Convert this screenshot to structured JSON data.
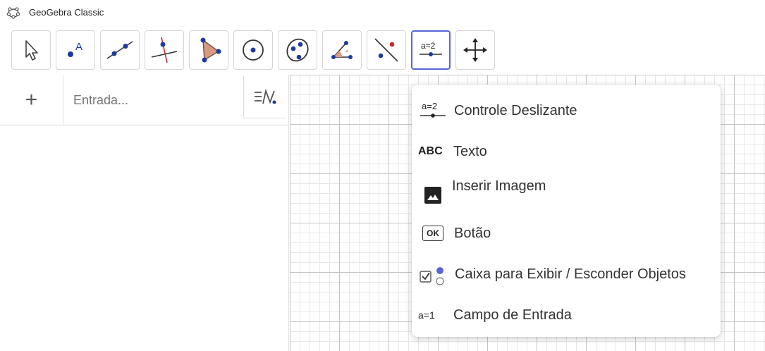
{
  "window": {
    "title": "GeoGebra Classic",
    "icon": "geogebra-logo-icon"
  },
  "toolbar": {
    "tools": [
      {
        "name": "move-tool",
        "icon": "cursor-arrow-icon"
      },
      {
        "name": "point-tool",
        "icon": "point-a-icon",
        "glyph": "A"
      },
      {
        "name": "line-tool",
        "icon": "line-through-points-icon"
      },
      {
        "name": "perpendicular-line-tool",
        "icon": "perpendicular-line-icon"
      },
      {
        "name": "polygon-tool",
        "icon": "polygon-icon"
      },
      {
        "name": "circle-tool",
        "icon": "circle-center-point-icon"
      },
      {
        "name": "ellipse-tool",
        "icon": "ellipse-icon"
      },
      {
        "name": "angle-tool",
        "icon": "angle-icon"
      },
      {
        "name": "reflect-tool",
        "icon": "reflect-about-line-icon"
      },
      {
        "name": "slider-tool",
        "icon": "slider-icon",
        "glyph": "a=2",
        "active": true
      },
      {
        "name": "move-graphics-view-tool",
        "icon": "move-graphics-view-icon"
      }
    ]
  },
  "algebra": {
    "add_label": "+",
    "input_placeholder": "Entrada...",
    "style_bar_icon": "algebra-style-icon"
  },
  "colors": {
    "accent": "#5a66d8",
    "point_blue": "#1d3a9e",
    "point_red": "#c2272d",
    "polygon_fill": "#d79a83"
  },
  "menu": {
    "items": [
      {
        "label": "Controle Deslizante",
        "icon": "slider-icon",
        "glyph": "a=2"
      },
      {
        "label": "Texto",
        "icon": "text-abc-icon",
        "glyph": "ABC"
      },
      {
        "label": "Inserir Imagem",
        "icon": "image-icon"
      },
      {
        "label": "Botão",
        "icon": "button-ok-icon",
        "glyph": "OK"
      },
      {
        "label": "Caixa para Exibir / Esconder Objetos",
        "icon": "checkbox-show-hide-icon"
      },
      {
        "label": "Campo de Entrada",
        "icon": "input-box-icon",
        "glyph": "a=1"
      }
    ]
  }
}
